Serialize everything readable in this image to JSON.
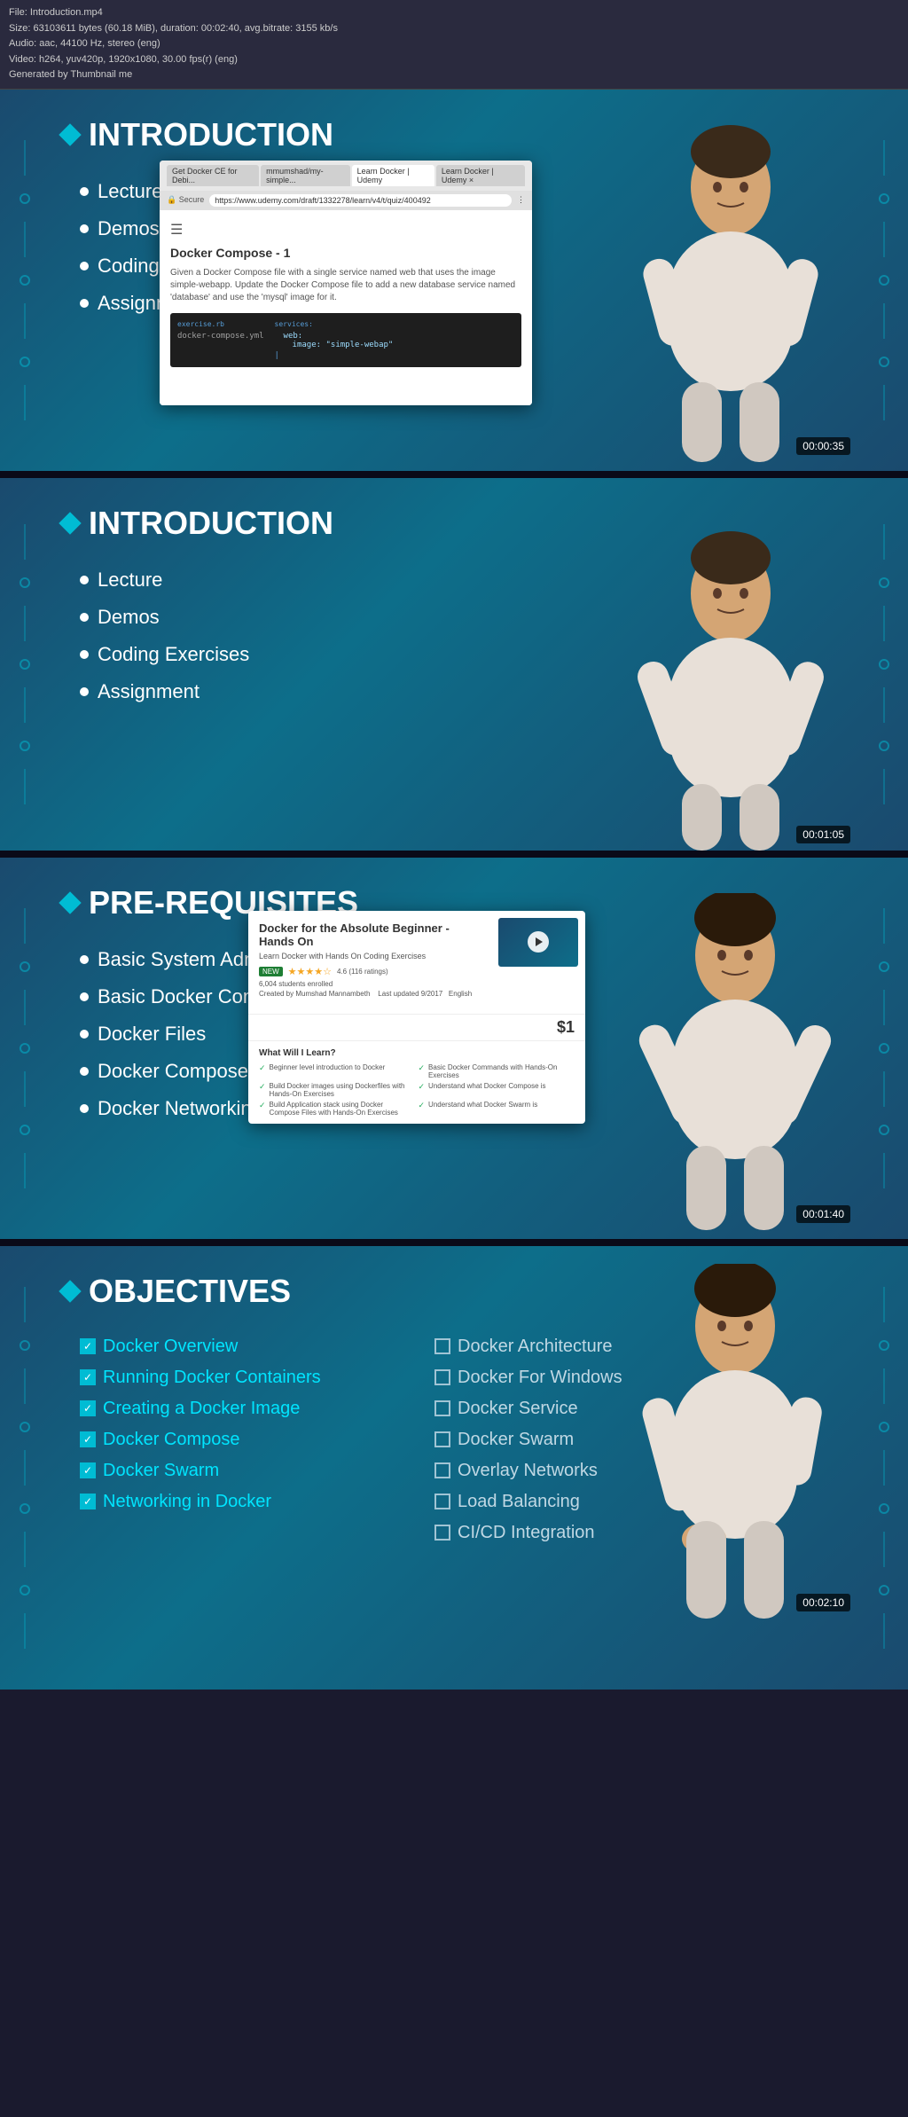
{
  "file_info": {
    "filename": "File: Introduction.mp4",
    "size": "Size: 63103611 bytes (60.18 MiB), duration: 00:02:40, avg.bitrate: 3155 kb/s",
    "audio": "Audio: aac, 44100 Hz, stereo (eng)",
    "video": "Video: h264, yuv420p, 1920x1080, 30.00 fps(r) (eng)",
    "generated": "Generated by Thumbnail me"
  },
  "sections": [
    {
      "id": "section-1",
      "type": "introduction",
      "title": "INTRODUCTION",
      "bullets": [
        "Lecture",
        "Demos",
        "Coding Exercises",
        "Assignment"
      ],
      "timestamp": "00:00:35",
      "has_screen": true,
      "screen": {
        "title": "Docker Compose - 1",
        "description": "Given a Docker Compose file with a single service named web that uses the image simple-webapp. Update the Docker Compose file to add a new database service named 'database' and use the 'mysql' image for it.",
        "code_file": "docker-compose.yml",
        "code_content": "services:\n  web:\n    image: \"simple-webap\"",
        "tabs": [
          "Get Docker CE for Debi...",
          "mmumshad/my-simple...",
          "Learn Docker | Udemy",
          "Learn Docker | Udemy"
        ],
        "url": "https://www.udemy.com/draft/1332278/learn/v4/t/quiz/400492"
      }
    },
    {
      "id": "section-2",
      "type": "introduction",
      "title": "INTRODUCTION",
      "bullets": [
        "Lecture",
        "Demos",
        "Coding Exercises",
        "Assignment"
      ],
      "timestamp": "00:01:05"
    },
    {
      "id": "section-3",
      "type": "pre-requisites",
      "title": "PRE-REQUISITES",
      "bullets": [
        "Basic System Administration",
        "Basic Docker Commands",
        "Docker Files",
        "Docker Compose",
        "Docker Networking"
      ],
      "timestamp": "00:01:40",
      "has_course_overlay": true,
      "course": {
        "title": "Docker for the Absolute Beginner - Hands On",
        "subtitle": "Learn Docker with Hands On Coding Exercises",
        "rating": "4.6 (116 ratings)",
        "students": "6,004 students enrolled",
        "creator": "Created by Mumshad Mannambeth",
        "updated": "Last updated 9/2017",
        "language": "English",
        "price": "$1",
        "learn_items": [
          "Beginner level introduction to Docker",
          "Basic Docker Commands with Hands-On Exercises",
          "Build Docker images using Dockerfiles with Hands-On Exercises",
          "Understand what Docker Compose is",
          "Build Application stack using Docker Compose Files with Hands-On Exercises",
          "Understand what Docker Swarm is"
        ]
      }
    },
    {
      "id": "section-4",
      "type": "objectives",
      "title": "OBJECTIVES",
      "timestamp": "00:02:10",
      "objectives_left": [
        {
          "label": "Docker Overview",
          "checked": true
        },
        {
          "label": "Running Docker Containers",
          "checked": true
        },
        {
          "label": "Creating a Docker Image",
          "checked": true
        },
        {
          "label": "Docker Compose",
          "checked": true
        },
        {
          "label": "Docker Swarm",
          "checked": true
        },
        {
          "label": "Networking in Docker",
          "checked": true
        }
      ],
      "objectives_right": [
        {
          "label": "Docker Architecture",
          "checked": false
        },
        {
          "label": "Docker For Windows",
          "checked": false
        },
        {
          "label": "Docker Service",
          "checked": false
        },
        {
          "label": "Docker Swarm",
          "checked": false
        },
        {
          "label": "Overlay Networks",
          "checked": false
        },
        {
          "label": "Load Balancing",
          "checked": false
        },
        {
          "label": "CI/CD Integration",
          "checked": false
        }
      ]
    }
  ]
}
